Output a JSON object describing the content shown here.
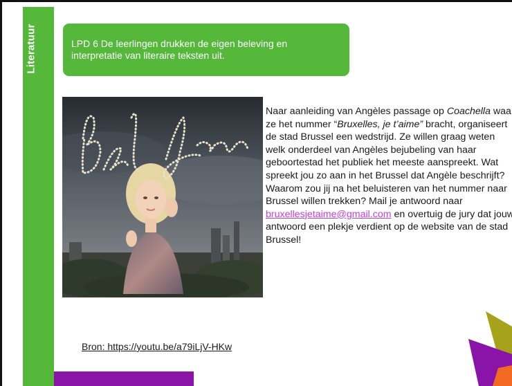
{
  "sidebar": {
    "label": "Literatuur"
  },
  "objective": {
    "text": "LPD 6 De leerlingen drukken de eigen beleving en interpretatie van literaire teksten uit."
  },
  "photo": {
    "handwriting": "Bxl Jtm"
  },
  "body": {
    "part1": "Naar aanleiding van Angèles passage op ",
    "coachella": "Coachella",
    "part2": " waar ze het nummer “",
    "song_title": "Bruxelles, je t’aime”",
    "part3": " bracht, organiseert de stad Brussel een wedstrijd. Ze willen graag weten welk onderdeel van Angèles bejubeling van haar geboortestad het publiek het meeste aanspreekt. Wat spreekt jou zo aan in het Brussel dat Angèle beschrijft? Waarom zou jij na het beluisteren van het nummer naar Brussel willen trekken? Mail je antwoord naar ",
    "email": "bruxellesjetaime@gmail.com",
    "part4": " en overtuig de jury dat jouw antwoord een plekje verdient op de website van de stad Brussel!"
  },
  "source": {
    "text": "Bron: https://youtu.be/a79iLjV-HKw"
  },
  "colors": {
    "green": "#55b83b",
    "purple": "#8a14a8",
    "link": "#c53dd8",
    "olive": "#a6a21a",
    "orange": "#f26a21"
  }
}
